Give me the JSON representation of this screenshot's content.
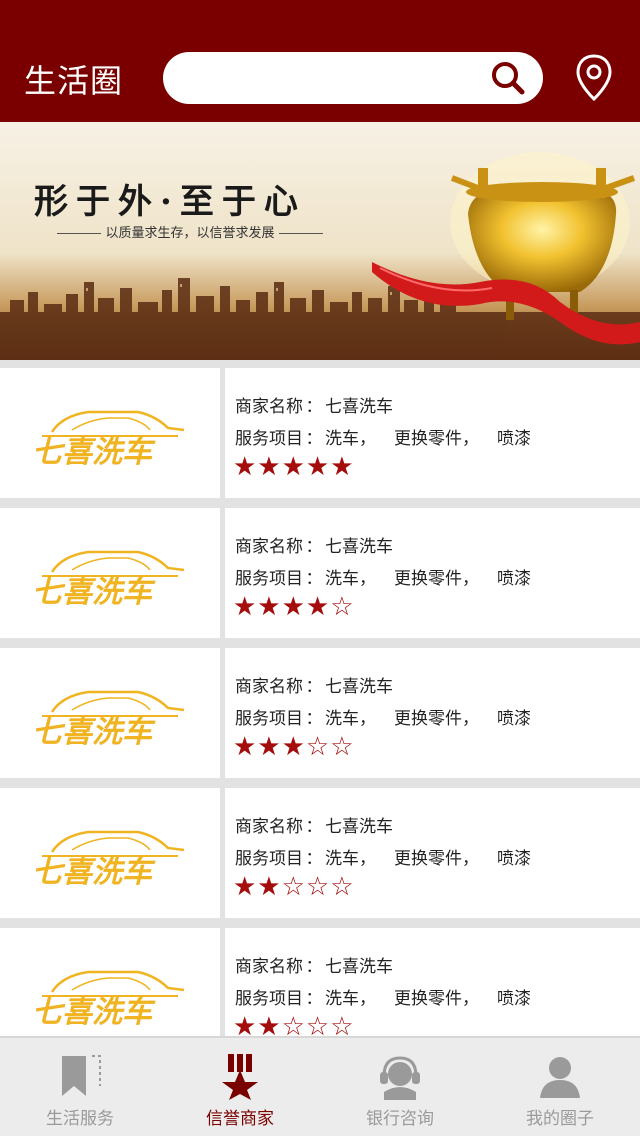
{
  "header": {
    "title": "生活圈",
    "search_placeholder": "",
    "search_value": ""
  },
  "banner": {
    "slogan": "形于外·至于心",
    "subslogan": "以质量求生存，以信誉求发展"
  },
  "merchant_label": "商家名称",
  "service_label": "服务项目",
  "colon": "：",
  "merchants": [
    {
      "logo_text": "七喜洗车",
      "name": "七喜洗车",
      "services": [
        "洗车，",
        "更换零件，",
        "喷漆"
      ],
      "stars": "★★★★★",
      "rating": 5
    },
    {
      "logo_text": "七喜洗车",
      "name": "七喜洗车",
      "services": [
        "洗车，",
        "更换零件，",
        "喷漆"
      ],
      "stars": "★★★★☆",
      "rating": 4
    },
    {
      "logo_text": "七喜洗车",
      "name": "七喜洗车",
      "services": [
        "洗车，",
        "更换零件，",
        "喷漆"
      ],
      "stars": "★★★☆☆",
      "rating": 3
    },
    {
      "logo_text": "七喜洗车",
      "name": "七喜洗车",
      "services": [
        "洗车，",
        "更换零件，",
        "喷漆"
      ],
      "stars": "★★☆☆☆",
      "rating": 2
    },
    {
      "logo_text": "七喜洗车",
      "name": "七喜洗车",
      "services": [
        "洗车，",
        "更换零件，",
        "喷漆"
      ],
      "stars": "★★☆☆☆",
      "rating": 2
    }
  ],
  "tabs": [
    {
      "label": "生活服务",
      "icon": "bookmark-icon",
      "active": false
    },
    {
      "label": "信誉商家",
      "icon": "medal-icon",
      "active": true
    },
    {
      "label": "银行咨询",
      "icon": "headset-icon",
      "active": false
    },
    {
      "label": "我的圈子",
      "icon": "person-icon",
      "active": false
    }
  ],
  "colors": {
    "brand": "#7a0000",
    "star": "#a50c0c",
    "logo": "#f0b321",
    "tab_inactive": "#9a9a9a"
  }
}
